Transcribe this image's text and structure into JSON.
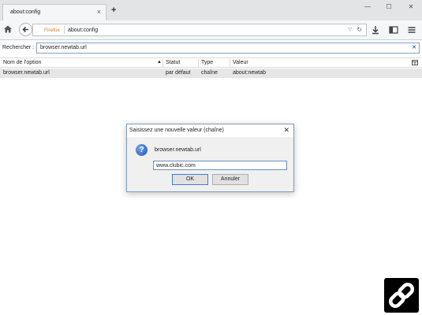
{
  "tab": {
    "title": "about:config",
    "close": "×"
  },
  "newtab": "+",
  "window": {
    "minimize": "—",
    "maximize": "☐",
    "close": "✕"
  },
  "urlbar": {
    "identity": "Firefox",
    "url": "about:config"
  },
  "search": {
    "label": "Rechercher :",
    "value": "browser.newtab.url",
    "clear": "✕"
  },
  "table": {
    "headers": [
      "Nom de l'option",
      "Statut",
      "Type",
      "Valeur"
    ],
    "rows": [
      {
        "name": "browser.newtab.url",
        "status": "par défaut",
        "type": "chaîne",
        "value": "about:newtab"
      }
    ]
  },
  "dialog": {
    "title": "Saisissez une nouvelle valeur (chaîne)",
    "close": "✕",
    "prompt": "browser.newtab.url",
    "value": "www.clubic.com",
    "ok_label": "OK",
    "cancel_label": "Annuler"
  },
  "colors": {
    "accent": "#3c7fd0",
    "identity": "#e8741a",
    "selected_row": "#e6e6e6"
  }
}
